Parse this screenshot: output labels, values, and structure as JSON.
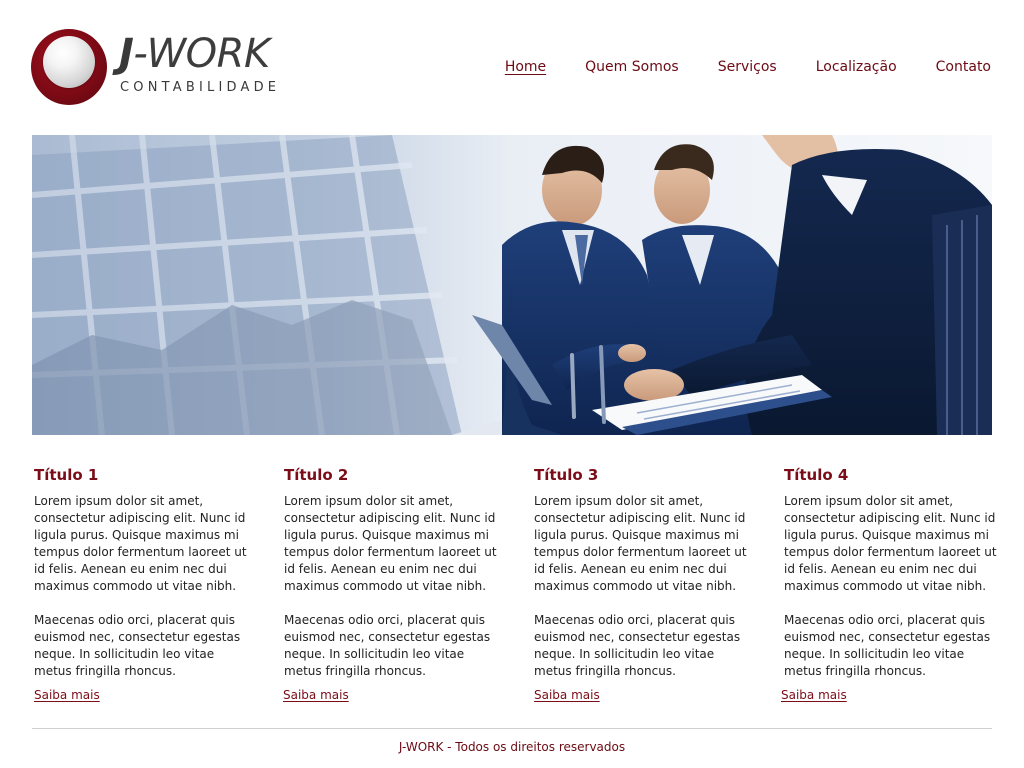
{
  "brand": {
    "name_initial": "J",
    "name_rest": "-WORK",
    "tagline": "CONTABILIDADE",
    "colors": {
      "accent": "#7a0d18",
      "nav": "#6b0b14"
    }
  },
  "nav": {
    "items": [
      {
        "label": "Home",
        "active": true
      },
      {
        "label": "Quem Somos",
        "active": false
      },
      {
        "label": "Serviços",
        "active": false
      },
      {
        "label": "Localização",
        "active": false
      },
      {
        "label": "Contato",
        "active": false
      }
    ]
  },
  "hero": {
    "image": "business-team-meeting-photo"
  },
  "columns": [
    {
      "title": "Título 1",
      "para1": "Lorem ipsum dolor sit amet, consectetur adipiscing elit. Nunc id ligula purus. Quisque maximus mi tempus dolor fermentum laoreet ut id felis. Aenean eu enim nec dui maximus commodo ut vitae nibh.",
      "para2": "Maecenas odio orci, placerat quis euismod nec, consectetur egestas neque. In sollicitudin leo vitae metus fringilla rhoncus.",
      "link": "Saiba mais"
    },
    {
      "title": "Título 2",
      "para1": "Lorem ipsum dolor sit amet, consectetur adipiscing elit. Nunc id ligula purus. Quisque maximus mi tempus dolor fermentum laoreet ut id felis. Aenean eu enim nec dui maximus commodo ut vitae nibh.",
      "para2": "Maecenas odio orci, placerat quis euismod nec, consectetur egestas neque. In sollicitudin leo vitae metus fringilla rhoncus.",
      "link": "Saiba mais"
    },
    {
      "title": "Título 3",
      "para1": "Lorem ipsum dolor sit amet, consectetur adipiscing elit. Nunc id ligula purus. Quisque maximus mi tempus dolor fermentum laoreet ut id felis. Aenean eu enim nec dui maximus commodo ut vitae nibh.",
      "para2": "Maecenas odio orci, placerat quis euismod nec, consectetur egestas neque. In sollicitudin leo vitae metus fringilla rhoncus.",
      "link": "Saiba mais"
    },
    {
      "title": "Título 4",
      "para1": "Lorem ipsum dolor sit amet, consectetur adipiscing elit. Nunc id ligula purus. Quisque maximus mi tempus dolor fermentum laoreet ut id felis. Aenean eu enim nec dui maximus commodo ut vitae nibh.",
      "para2": "Maecenas odio orci, placerat quis euismod nec, consectetur egestas neque. In sollicitudin leo vitae metus fringilla rhoncus.",
      "link": "Saiba mais"
    }
  ],
  "footer": {
    "text": "J-WORK - Todos os direitos reservados"
  }
}
